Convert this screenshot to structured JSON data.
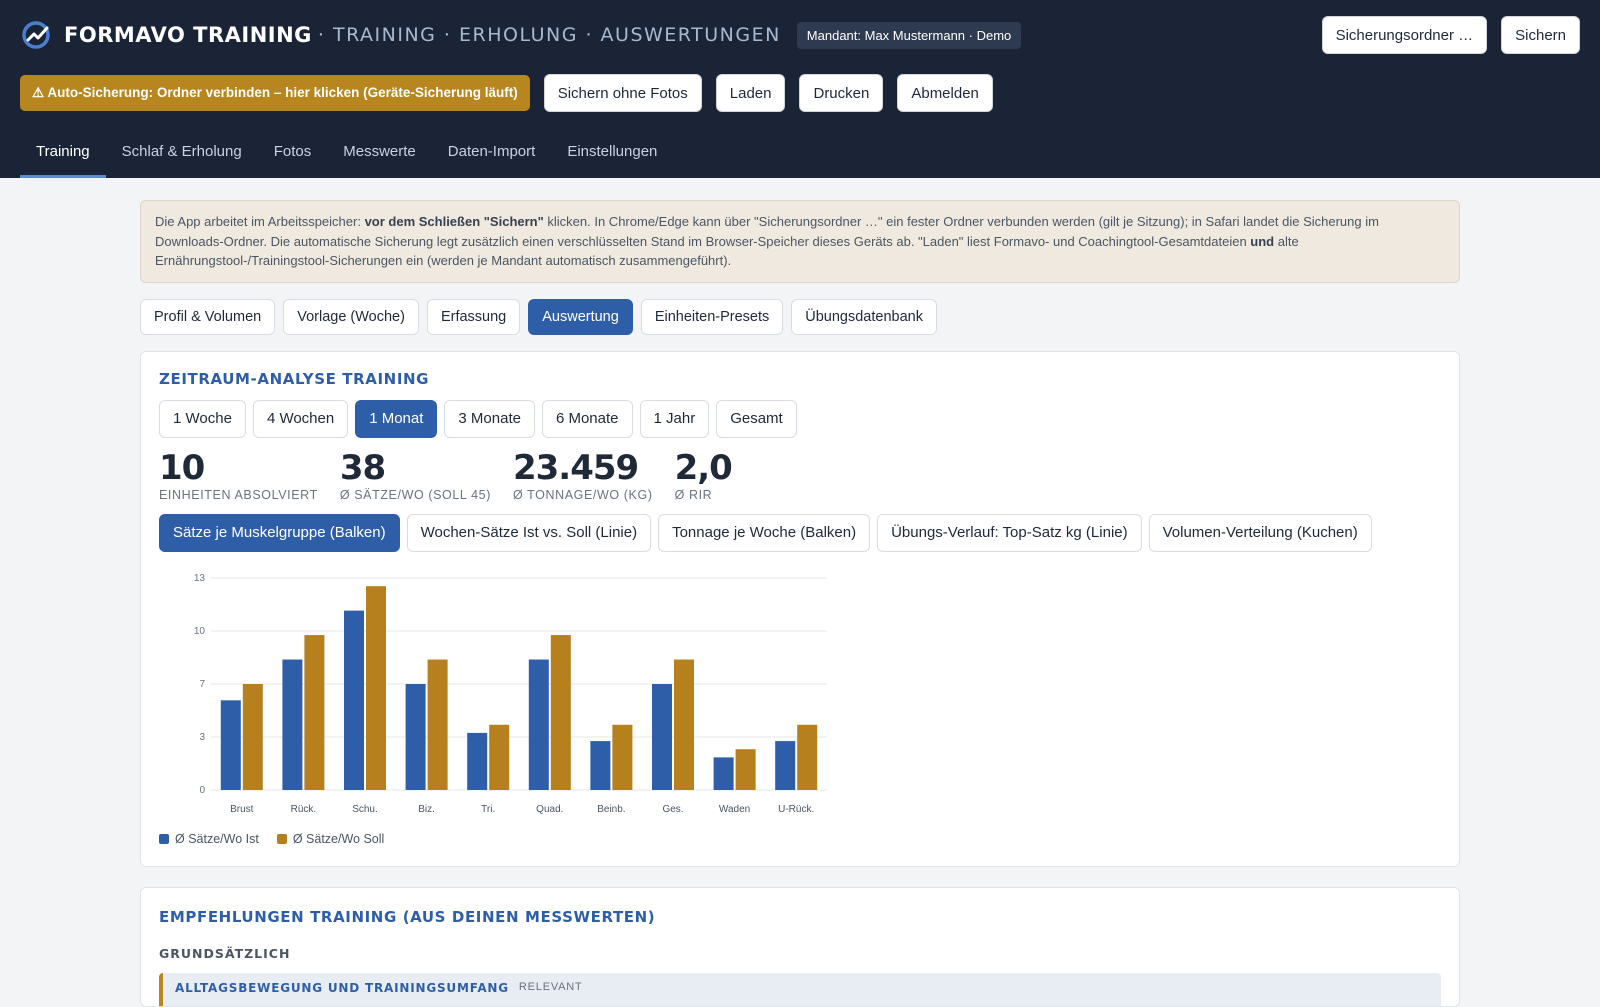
{
  "header": {
    "brand": "FORMAVO TRAINING",
    "brand_sub": "· TRAINING · ERHOLUNG · AUSWERTUNGEN",
    "tenant_badge": "Mandant: Max Mustermann · Demo",
    "backup_folder_label": "Sicherungsordner …",
    "save_label": "Sichern",
    "auto_backup_warning": "⚠ Auto-Sicherung: Ordner verbinden – hier klicken (Geräte-Sicherung läuft)",
    "actions": [
      "Sichern ohne Fotos",
      "Laden",
      "Drucken",
      "Abmelden"
    ]
  },
  "main_tabs": [
    "Training",
    "Schlaf & Erholung",
    "Fotos",
    "Messwerte",
    "Daten-Import",
    "Einstellungen"
  ],
  "info": {
    "p1": "Die App arbeitet im Arbeitsspeicher: ",
    "b1": "vor dem Schließen \"Sichern\"",
    "p2": " klicken. In Chrome/Edge kann über \"Sicherungsordner …\" ein fester Ordner verbunden werden (gilt je Sitzung); in Safari landet die Sicherung im Downloads-Ordner. Die automatische Sicherung legt zusätzlich einen verschlüsselten Stand im Browser-Speicher dieses Geräts ab. \"Laden\" liest Formavo- und Coachingtool-Gesamtdateien ",
    "b2": "und",
    "p3": " alte Ernährungstool-/Trainingstool-Sicherungen ein (werden je Mandant automatisch zusammengeführt)."
  },
  "sub_tabs": [
    "Profil & Volumen",
    "Vorlage (Woche)",
    "Erfassung",
    "Auswertung",
    "Einheiten-Presets",
    "Übungsdatenbank"
  ],
  "analysis": {
    "title": "Zeitraum-Analyse Training",
    "periods": [
      "1 Woche",
      "4 Wochen",
      "1 Monat",
      "3 Monate",
      "6 Monate",
      "1 Jahr",
      "Gesamt"
    ],
    "kpis": [
      {
        "value": "10",
        "label": "Einheiten absolviert"
      },
      {
        "value": "38",
        "label": "Ø Sätze/Wo (Soll 45)"
      },
      {
        "value": "23.459",
        "label": "Ø Tonnage/Wo (kg)"
      },
      {
        "value": "2,0",
        "label": "Ø RIR"
      }
    ],
    "chart_tabs": [
      "Sätze je Muskelgruppe (Balken)",
      "Wochen-Sätze Ist vs. Soll (Linie)",
      "Tonnage je Woche (Balken)",
      "Übungs-Verlauf: Top-Satz kg (Linie)",
      "Volumen-Verteilung (Kuchen)"
    ]
  },
  "chart_data": {
    "type": "bar",
    "categories": [
      "Brust",
      "Rück.",
      "Schu.",
      "Biz.",
      "Tri.",
      "Quad.",
      "Beinb.",
      "Ges.",
      "Waden",
      "U-Rück."
    ],
    "series": [
      {
        "name": "Ø Sätze/Wo Ist",
        "color": "#2f5ea8",
        "values": [
          5.5,
          8,
          11,
          6.5,
          3.5,
          8,
          3,
          6.5,
          2,
          3
        ]
      },
      {
        "name": "Ø Sätze/Wo Soll",
        "color": "#b5801d",
        "values": [
          6.5,
          9.5,
          12.5,
          8,
          4,
          9.5,
          4,
          8,
          2.5,
          4
        ]
      }
    ],
    "yticks": [
      "0",
      "3",
      "7",
      "10",
      "13"
    ],
    "ylim": [
      0,
      13
    ],
    "grid": true,
    "legend": "bottom-left"
  },
  "recommendations": {
    "title": "Empfehlungen Training (aus deinen Messwerten)",
    "section": "Grundsätzlich",
    "item_title": "Alltagsbewegung und Trainingsumfang",
    "item_tag": "Relevant"
  }
}
